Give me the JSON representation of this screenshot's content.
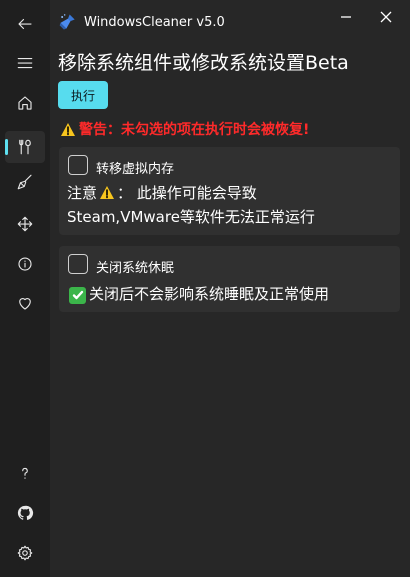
{
  "app": {
    "title": "WindowsCleaner v5.0"
  },
  "sidebar": {
    "items": [
      {
        "icon": "back-arrow-icon"
      },
      {
        "icon": "hamburger-menu-icon"
      },
      {
        "icon": "home-icon"
      },
      {
        "icon": "tools-icon",
        "active": true
      },
      {
        "icon": "broom-icon"
      },
      {
        "icon": "move-icon"
      },
      {
        "icon": "info-icon"
      },
      {
        "icon": "heart-icon"
      },
      {
        "icon": "help-icon"
      },
      {
        "icon": "github-icon"
      },
      {
        "icon": "settings-icon"
      }
    ]
  },
  "main": {
    "page_title": "移除系统组件或修改系统设置Beta",
    "run_label": "执行",
    "warning": "警告：未勾选的项在执行时会被恢复!",
    "options": [
      {
        "label": "转移虚拟内存",
        "checked": false,
        "note_prefix": "注意",
        "note_line1_suffix": "：  此操作可能会导致",
        "note_line2": "Steam,VMware等软件无法正常运行"
      },
      {
        "label": "关闭系统休眠",
        "checked": false,
        "note": "关闭后不会影响系统睡眠及正常使用"
      }
    ]
  },
  "colors": {
    "accent": "#57dcee",
    "warning": "#ff2a2a",
    "ok": "#3bb54a",
    "background": "#272727",
    "card": "#303030"
  }
}
